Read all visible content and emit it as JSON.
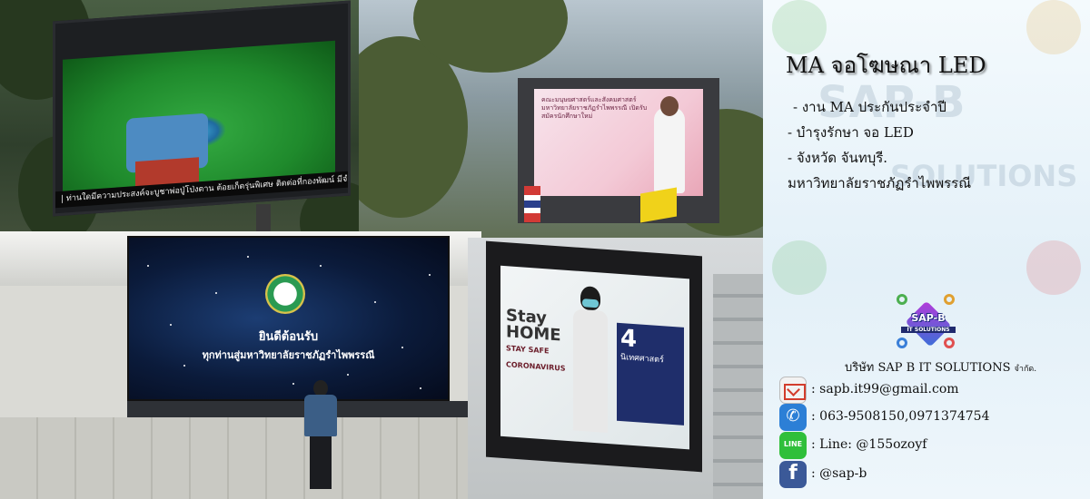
{
  "info": {
    "title": "MA จอโฆษณา LED",
    "bullets": [
      "- งาน MA ประกันประจำปี",
      "- บำรุงรักษา จอ LED",
      "- จังหวัด จันทบุรี.",
      "มหาวิทยาลัยราชภัฏรำไพพรรณี"
    ],
    "logo": {
      "name": "SAP-B",
      "sub": "IT SOLUTIONS"
    },
    "company": {
      "name": "บริษัท SAP B IT SOLUTIONS",
      "suffix": "จำกัด."
    },
    "watermark": {
      "line1": "SAP-B",
      "line2": "SOLUTIONS"
    },
    "contacts": [
      {
        "icon": "gmail-icon",
        "text": ": sapb.it99@gmail.com"
      },
      {
        "icon": "phone-icon",
        "text": ": 063-9508150,0971374754"
      },
      {
        "icon": "line-icon",
        "icon_label": "LINE",
        "text": ": Line: @155ozoyf"
      },
      {
        "icon": "facebook-icon",
        "text": ": @sap-b"
      }
    ]
  },
  "photos": {
    "p1_ticker": "| ท่านใดมีความประสงค์จะบูชาพ่อปู่โป่งตาน ต้อยเก็ดรุ่นพิเศษ ติดต่อที่กองพัฒน์ มีจำนวนจำกัด ข",
    "p2_screen_text": "คณะมนุษยศาสตร์และสังคมศาสตร์ มหาวิทยาลัยราชภัฏรำไพพรรณี เปิดรับสมัครนักศึกษาใหม่",
    "p3_line1": "ยินดีต้อนรับ",
    "p3_line2": "ทุกท่านสู่มหาวิทยาลัยราชภัฏรำไพพรรณี",
    "p4_stay": "Stay HOME",
    "p4_stay_sub": "STAY SAFE CORONAVIRUS",
    "p4_ad_big": "4",
    "p4_ad_text": "นิเทศศาสตร์"
  },
  "colors": {
    "panel_bg": "#e9f4fb",
    "gmail_red": "#d23c2c",
    "phone_blue": "#2c7fd6",
    "line_green": "#2fbf3a",
    "facebook_blue": "#3b5998"
  }
}
